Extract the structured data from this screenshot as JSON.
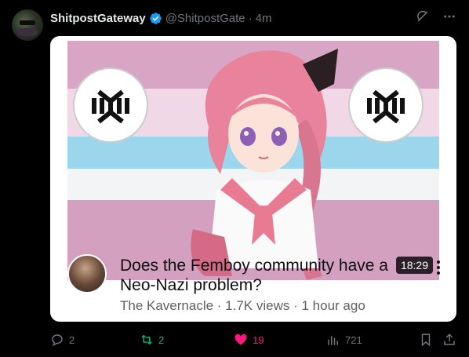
{
  "post": {
    "display_name": "ShitpostGateway",
    "handle": "@ShitpostGate",
    "separator": "·",
    "time": "4m"
  },
  "card": {
    "duration": "18:29",
    "title": "Does the Femboy community have a Neo-Nazi problem?",
    "meta": "The Kavernacle · 1.7K views · 1 hour ago"
  },
  "actions": {
    "replies": "2",
    "reposts": "2",
    "likes": "19",
    "views": "721"
  },
  "colors": {
    "verified": "#1d9bf0",
    "repost_active": "#00ba7c",
    "like_active": "#f91880",
    "muted": "#71767b"
  },
  "icons": [
    "verified-badge-icon",
    "grok-icon",
    "more-icon",
    "reply-icon",
    "repost-icon",
    "like-icon",
    "views-icon",
    "bookmark-icon",
    "share-icon",
    "kebab-icon"
  ]
}
